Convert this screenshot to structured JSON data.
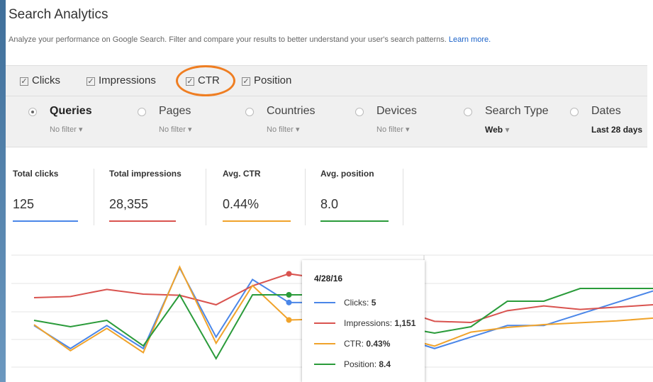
{
  "header": {
    "title": "Search Analytics",
    "description": "Analyze your performance on Google Search. Filter and compare your results to better understand your user's search patterns.",
    "learn_more": "Learn more."
  },
  "metrics": [
    {
      "label": "Clicks",
      "checked": true
    },
    {
      "label": "Impressions",
      "checked": true
    },
    {
      "label": "CTR",
      "checked": true
    },
    {
      "label": "Position",
      "checked": true
    }
  ],
  "groupings": [
    {
      "name": "Queries",
      "filter": "No filter",
      "selected": true
    },
    {
      "name": "Pages",
      "filter": "No filter",
      "selected": false
    },
    {
      "name": "Countries",
      "filter": "No filter",
      "selected": false
    },
    {
      "name": "Devices",
      "filter": "No filter",
      "selected": false
    },
    {
      "name": "Search Type",
      "filter": "Web",
      "selected": false
    },
    {
      "name": "Dates",
      "filter": "Last 28 days",
      "selected": false
    }
  ],
  "stats": [
    {
      "label": "Total clicks",
      "value": "125",
      "color": "#4a86e8"
    },
    {
      "label": "Total impressions",
      "value": "28,355",
      "color": "#d9534f"
    },
    {
      "label": "Avg. CTR",
      "value": "0.44%",
      "color": "#f0a32b"
    },
    {
      "label": "Avg. position",
      "value": "8.0",
      "color": "#2a9b3a"
    }
  ],
  "tooltip": {
    "date": "4/28/16",
    "rows": [
      {
        "label": "Clicks:",
        "value": "5",
        "color": "#4a86e8"
      },
      {
        "label": "Impressions:",
        "value": "1,151",
        "color": "#d9534f"
      },
      {
        "label": "CTR:",
        "value": "0.43%",
        "color": "#f0a32b"
      },
      {
        "label": "Position:",
        "value": "8.4",
        "color": "#2a9b3a"
      }
    ]
  },
  "chart_data": {
    "type": "line",
    "x_index": [
      0,
      1,
      2,
      3,
      4,
      5,
      6,
      7,
      8,
      9,
      10,
      11,
      12,
      13,
      14,
      15,
      16,
      17
    ],
    "series": [
      {
        "name": "Clicks",
        "color": "#4a86e8",
        "values": [
          3,
          1,
          3,
          1,
          8,
          2,
          7,
          5,
          5,
          4,
          2,
          1,
          2,
          3,
          3,
          4,
          5,
          6
        ]
      },
      {
        "name": "Impressions",
        "color": "#d9534f",
        "values": [
          1050,
          1055,
          1085,
          1065,
          1060,
          1020,
          1100,
          1151,
          1130,
          1110,
          1000,
          950,
          945,
          995,
          1015,
          1000,
          1010,
          1020
        ]
      },
      {
        "name": "CTR",
        "color": "#f0a32b",
        "values": [
          0.38,
          0.1,
          0.34,
          0.08,
          1.0,
          0.18,
          0.8,
          0.43,
          0.44,
          0.42,
          0.25,
          0.15,
          0.3,
          0.35,
          0.38,
          0.4,
          0.42,
          0.45
        ]
      },
      {
        "name": "Position",
        "color": "#2a9b3a",
        "values": [
          8.8,
          8.9,
          8.8,
          9.2,
          8.4,
          9.4,
          8.4,
          8.4,
          8.4,
          8.6,
          8.9,
          9.0,
          8.9,
          8.5,
          8.5,
          8.3,
          8.3,
          8.3
        ]
      }
    ],
    "highlight_index": 7
  }
}
